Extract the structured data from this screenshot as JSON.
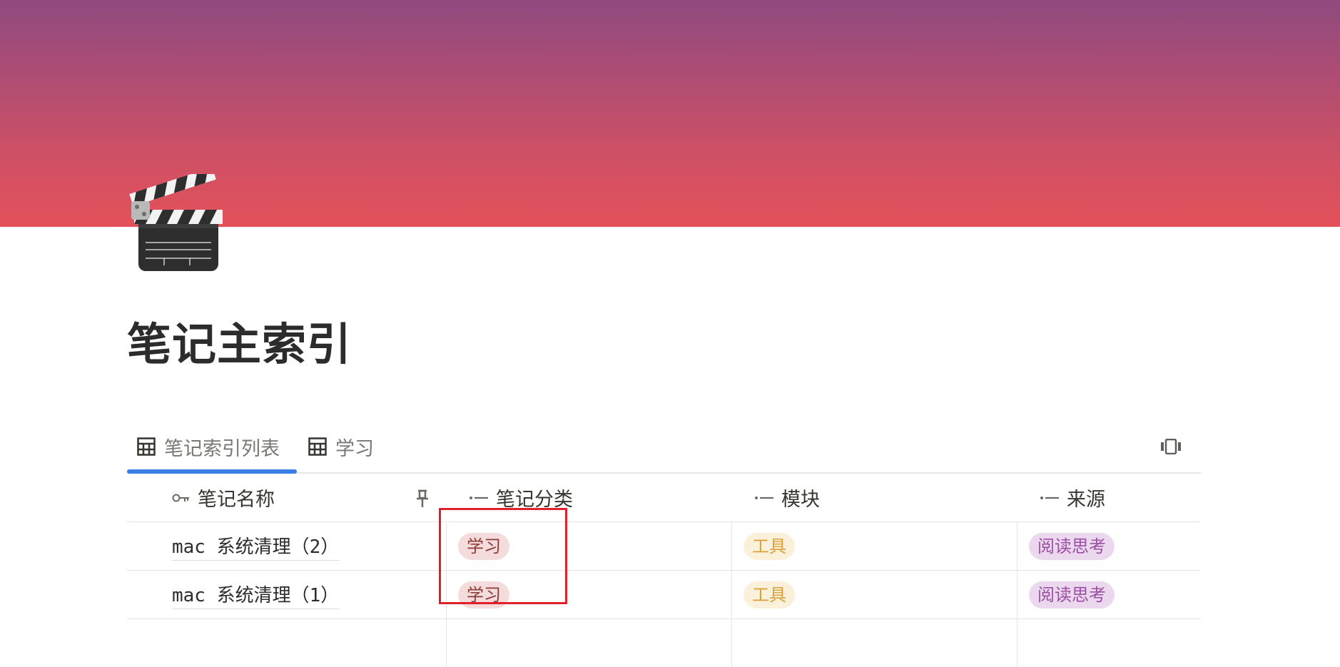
{
  "page": {
    "title": "笔记主索引",
    "icon": "clapperboard-icon",
    "cover_colors": [
      "#8f4a7f",
      "#e4515a"
    ]
  },
  "tabs": [
    {
      "label": "笔记索引列表",
      "icon": "table-grid-icon",
      "active": true
    },
    {
      "label": "学习",
      "icon": "table-grid-icon",
      "active": false
    }
  ],
  "accent_color": "#3a7ee8",
  "table": {
    "columns": [
      {
        "label": "笔记名称",
        "icon": "key-icon"
      },
      {
        "label": "笔记分类",
        "icon": "select-property-icon"
      },
      {
        "label": "模块",
        "icon": "select-property-icon"
      },
      {
        "label": "来源",
        "icon": "select-property-icon"
      }
    ],
    "rows": [
      {
        "name": "mac 系统清理（2）",
        "category": "学习",
        "module": "工具",
        "source": "阅读思考"
      },
      {
        "name": "mac 系统清理（1）",
        "category": "学习",
        "module": "工具",
        "source": "阅读思考"
      }
    ],
    "tag_colors": {
      "学习": {
        "bg": "#f5dcdc",
        "fg": "#8c3b36"
      },
      "工具": {
        "bg": "#fbf0d9",
        "fg": "#d9a23a"
      },
      "阅读思考": {
        "bg": "#ecd8ee",
        "fg": "#9a4fa3"
      }
    }
  },
  "annotation": {
    "highlight_color": "#e0202a"
  }
}
